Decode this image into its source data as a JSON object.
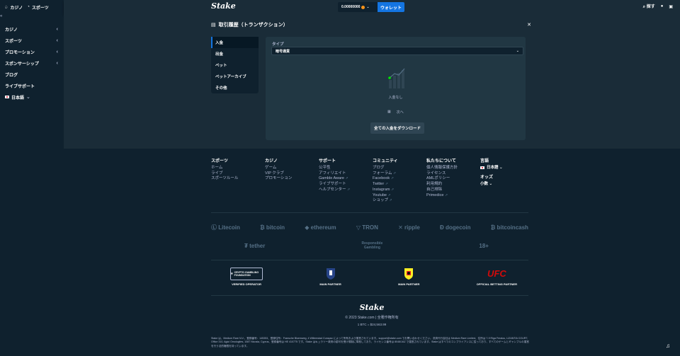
{
  "sidebar": {
    "tabs": [
      {
        "label": "カジノ"
      },
      {
        "label": "スポーツ"
      }
    ],
    "items": [
      {
        "label": "カジノ",
        "chevron": true
      },
      {
        "label": "スポーツ",
        "chevron": true
      },
      {
        "label": "プロモーション",
        "chevron": true
      },
      {
        "label": "スポンサーシップ",
        "chevron": true
      },
      {
        "label": "ブログ",
        "chevron": false
      },
      {
        "label": "ライブサポート",
        "chevron": false
      }
    ],
    "language": "日本語"
  },
  "header": {
    "logo": "Stake",
    "balance": "0.00000000",
    "wallet_label": "ウォレット",
    "search_label": "探す"
  },
  "modal": {
    "title": "取引履歴（トランザクション）",
    "menu": [
      {
        "label": "入金",
        "active": true
      },
      {
        "label": "出金",
        "active": false
      },
      {
        "label": "ベット",
        "active": false
      },
      {
        "label": "ベットアーカイブ",
        "active": false
      },
      {
        "label": "その他",
        "active": false
      }
    ],
    "type_label": "タイプ",
    "type_value": "暗号通貨",
    "empty_text": "入金なし",
    "pager_next": "次へ",
    "download_label": "全ての入金をダウンロード"
  },
  "footer": {
    "columns": [
      {
        "title": "スポーツ",
        "links": [
          {
            "t": "ホーム"
          },
          {
            "t": "ライブ"
          },
          {
            "t": "スポーツルール"
          }
        ]
      },
      {
        "title": "カジノ",
        "links": [
          {
            "t": "ゲーム"
          },
          {
            "t": "VIP クラブ"
          },
          {
            "t": "プロモーション"
          }
        ]
      },
      {
        "title": "サポート",
        "links": [
          {
            "t": "公平性"
          },
          {
            "t": "アフィリエイト"
          },
          {
            "t": "Gamble Aware",
            "ext": true
          },
          {
            "t": "ライブサポート"
          },
          {
            "t": "ヘルプセンター",
            "ext": true
          }
        ]
      },
      {
        "title": "コミュニティ",
        "links": [
          {
            "t": "ブログ"
          },
          {
            "t": "フォーラム",
            "ext": true
          },
          {
            "t": "Facebook",
            "ext": true
          },
          {
            "t": "Twitter",
            "ext": true
          },
          {
            "t": "Instagram",
            "ext": true
          },
          {
            "t": "Youtube",
            "ext": true
          },
          {
            "t": "ショップ",
            "ext": true
          }
        ]
      },
      {
        "title": "私たちについて",
        "links": [
          {
            "t": "個人情報保護方針"
          },
          {
            "t": "ライセンス"
          },
          {
            "t": "AMLポリシー"
          },
          {
            "t": "利用規約"
          },
          {
            "t": "自己排除"
          },
          {
            "t": "Primedice",
            "ext": true
          }
        ]
      }
    ],
    "lang_title": "言語",
    "lang_value": "日本語",
    "odds_title": "オッズ",
    "odds_value": "小数",
    "crypto1": [
      "Litecoin",
      "bitcoin",
      "ethereum",
      "TRON",
      "ripple",
      "dogecoin",
      "bitcoincash"
    ],
    "tether": "tether",
    "responsible": "Responsible Gambling",
    "age": "18+",
    "partners": [
      {
        "label": "VERIFIED OPERATOR",
        "badge": "CRYPTO GAMBLING FOUNDATION"
      },
      {
        "label": "MAIN PARTNER",
        "badge": ""
      },
      {
        "label": "MAIN PARTNER",
        "badge": ""
      },
      {
        "label": "OFFICIAL BETTING PARTNER",
        "badge": "UFC"
      }
    ],
    "logo": "Stake",
    "copyright": "© 2023 Stake.com | 全著作権所有",
    "rate": "1 BTC = $24,563.99",
    "legal": "Stake は、Medium Rare N.V.、登録番号：145353、登録住所：Fransche Bloemweg, 4 Willemstad Curaçao によって所有および運営されています。support@stake.com でお問い合わせください。決済代行会社は Medium Rare Limited、住所は 7-9 Riga Feraiou, LIZANTIA COURT, Office 310, Agioi Omologites, 1087 Nicosia, Cyprus、登録番号は HE 410775 です。Stake はキュラソー政府の認可を受け規制に準拠しており、ライセンス番号は 8048/JAZ で運営されています。Stake はすべてのコンプライアンスに従っており、すべてのゲームとギャンブルの運営を行う法的権限を持っています。"
  }
}
